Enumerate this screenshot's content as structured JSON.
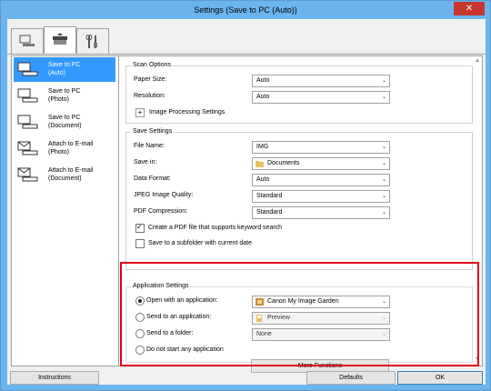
{
  "window": {
    "title": "Settings (Save to PC (Auto))",
    "close_glyph": "✕"
  },
  "tabs": [
    {
      "name": "scan-from-computer-tab",
      "icon": "computer-scanner-icon"
    },
    {
      "name": "scan-from-operation-panel-tab",
      "icon": "scanner-icon"
    },
    {
      "name": "general-settings-tab",
      "icon": "tools-icon"
    }
  ],
  "sidebar": {
    "items": [
      {
        "line1": "Save to PC",
        "line2": "(Auto)",
        "selected": true
      },
      {
        "line1": "Save to PC",
        "line2": "(Photo)",
        "selected": false
      },
      {
        "line1": "Save to PC",
        "line2": "(Document)",
        "selected": false
      },
      {
        "line1": "Attach to E-mail",
        "line2": "(Photo)",
        "selected": false
      },
      {
        "line1": "Attach to E-mail",
        "line2": "(Document)",
        "selected": false
      }
    ]
  },
  "scan_options": {
    "title": "Scan Options",
    "paper_size_label": "Paper Size:",
    "paper_size_value": "Auto",
    "resolution_label": "Resolution:",
    "resolution_value": "Auto",
    "image_processing_label": "Image Processing Settings",
    "plus_glyph": "+"
  },
  "save_settings": {
    "title": "Save Settings",
    "file_name_label": "File Name:",
    "file_name_value": "IMG",
    "save_in_label": "Save in:",
    "save_in_value": "Documents",
    "data_format_label": "Data Format:",
    "data_format_value": "Auto",
    "jpeg_quality_label": "JPEG Image Quality:",
    "jpeg_quality_value": "Standard",
    "pdf_compression_label": "PDF Compression:",
    "pdf_compression_value": "Standard",
    "keyword_search_label": "Create a PDF file that supports keyword search",
    "keyword_search_checked": true,
    "subfolder_label": "Save to a subfolder with current date",
    "subfolder_checked": false
  },
  "application_settings": {
    "title": "Application Settings",
    "open_app_label": "Open with an application:",
    "open_app_value": "Canon My Image Garden",
    "send_app_label": "Send to an application:",
    "send_app_value": "Preview",
    "send_folder_label": "Send to a folder:",
    "send_folder_value": "None",
    "no_app_label": "Do not start any application",
    "more_functions_label": "More Functions"
  },
  "footer": {
    "instructions_label": "Instructions",
    "defaults_label": "Defaults",
    "ok_label": "OK"
  },
  "colors": {
    "titlebar": "#6cb4ee",
    "selection": "#3399ff",
    "highlight": "#e0001a",
    "close_button": "#c7372f"
  },
  "dropdown_glyph": "⌄"
}
